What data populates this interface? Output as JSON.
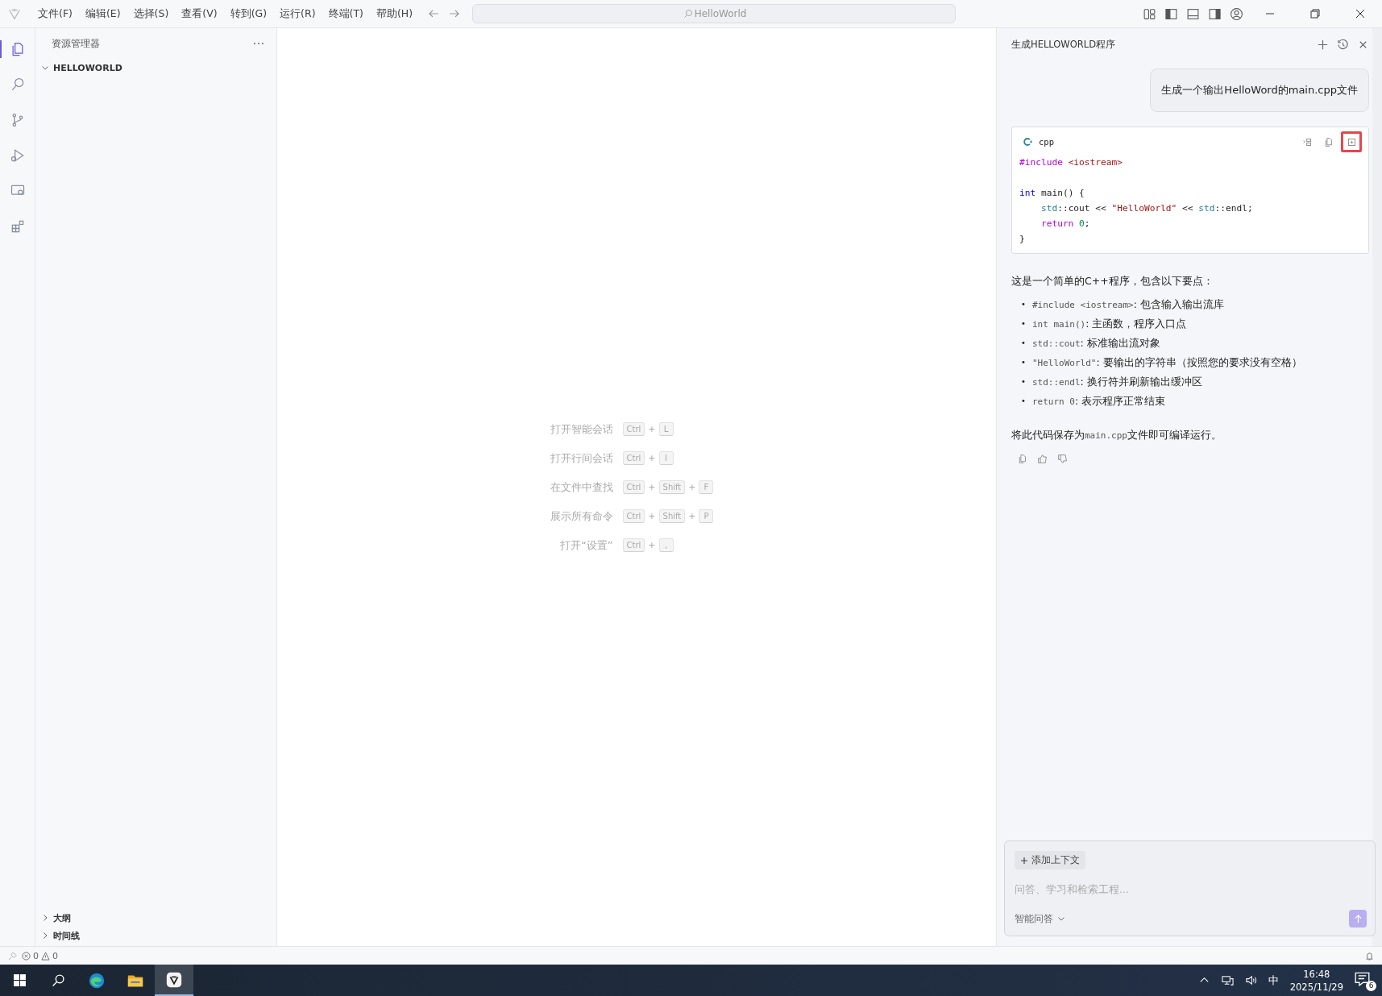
{
  "menu": [
    "文件(F)",
    "编辑(E)",
    "选择(S)",
    "查看(V)",
    "转到(G)",
    "运行(R)",
    "终端(T)",
    "帮助(H)"
  ],
  "title_search": {
    "placeholder": "HelloWorld"
  },
  "activity_bar": [
    {
      "kind": "explorer",
      "selected": true
    },
    {
      "kind": "search",
      "selected": false
    },
    {
      "kind": "source-control",
      "selected": false
    },
    {
      "kind": "run",
      "selected": false
    },
    {
      "kind": "remote",
      "selected": false
    },
    {
      "kind": "extensions",
      "selected": false
    }
  ],
  "explorer": {
    "title": "资源管理器",
    "folder": {
      "label": "HELLOWORLD",
      "expanded": true
    },
    "sections": [
      {
        "label": "大纲",
        "expanded": false
      },
      {
        "label": "时间线",
        "expanded": false
      }
    ]
  },
  "shortcuts": [
    {
      "label": "打开智能会话",
      "keys": [
        {
          "kind": "key",
          "text": "Ctrl"
        },
        {
          "kind": "plus",
          "text": "+"
        },
        {
          "kind": "key",
          "text": "L"
        }
      ]
    },
    {
      "label": "打开行间会话",
      "keys": [
        {
          "kind": "key",
          "text": "Ctrl"
        },
        {
          "kind": "plus",
          "text": "+"
        },
        {
          "kind": "key",
          "text": "I"
        }
      ]
    },
    {
      "label": "在文件中查找",
      "keys": [
        {
          "kind": "key",
          "text": "Ctrl"
        },
        {
          "kind": "plus",
          "text": "+"
        },
        {
          "kind": "key",
          "text": "Shift"
        },
        {
          "kind": "plus",
          "text": "+"
        },
        {
          "kind": "key",
          "text": "F"
        }
      ]
    },
    {
      "label": "展示所有命令",
      "keys": [
        {
          "kind": "key",
          "text": "Ctrl"
        },
        {
          "kind": "plus",
          "text": "+"
        },
        {
          "kind": "key",
          "text": "Shift"
        },
        {
          "kind": "plus",
          "text": "+"
        },
        {
          "kind": "key",
          "text": "P"
        }
      ]
    },
    {
      "label": "打开“设置”",
      "keys": [
        {
          "kind": "key",
          "text": "Ctrl"
        },
        {
          "kind": "plus",
          "text": "+"
        },
        {
          "kind": "key",
          "text": ","
        }
      ]
    }
  ],
  "chat": {
    "title": "生成HELLOWORLD程序",
    "user_message": "生成一个输出HelloWord的main.cpp文件",
    "code_block": {
      "language": "cpp",
      "actions": [
        {
          "kind": "insert",
          "highlighted": false
        },
        {
          "kind": "copy",
          "highlighted": false
        },
        {
          "kind": "apply",
          "highlighted": true
        }
      ],
      "lines": [
        {
          "kind": "code",
          "tokens": [
            {
              "kind": "directive",
              "text": "#include"
            },
            {
              "kind": "header",
              "text": " <iostream>"
            }
          ]
        },
        {
          "kind": "blank"
        },
        {
          "kind": "code",
          "tokens": [
            {
              "kind": "keyword",
              "text": "int"
            },
            {
              "kind": "plain",
              "text": " main() {"
            }
          ]
        },
        {
          "kind": "code",
          "tokens": [
            {
              "kind": "namespace",
              "text": "    std"
            },
            {
              "kind": "plain",
              "text": "::cout << "
            },
            {
              "kind": "string",
              "text": "\"HelloWorld\""
            },
            {
              "kind": "plain",
              "text": " << "
            },
            {
              "kind": "namespace",
              "text": "std"
            },
            {
              "kind": "plain",
              "text": "::endl;"
            }
          ]
        },
        {
          "kind": "code",
          "tokens": [
            {
              "kind": "control",
              "text": "    return"
            },
            {
              "kind": "number",
              "text": " 0"
            },
            {
              "kind": "plain",
              "text": ";"
            }
          ]
        },
        {
          "kind": "code",
          "tokens": [
            {
              "kind": "plain",
              "text": "}"
            }
          ]
        }
      ]
    },
    "intro": "这是一个简单的C++程序，包含以下要点：",
    "points": [
      {
        "marker": "•",
        "code": "#include <iostream>",
        "text": ": 包含输入输出流库"
      },
      {
        "marker": "•",
        "code": "int main()",
        "text": ": 主函数，程序入口点"
      },
      {
        "marker": "•",
        "code": "std::cout",
        "text": ": 标准输出流对象"
      },
      {
        "marker": "•",
        "code": "\"HelloWorld\"",
        "text": ": 要输出的字符串（按照您的要求没有空格）"
      },
      {
        "marker": "•",
        "code": "std::endl",
        "text": ": 换行符并刷新输出缓冲区"
      },
      {
        "marker": "•",
        "code": "return 0",
        "text": ": 表示程序正常结束"
      }
    ],
    "closing": [
      {
        "kind": "text",
        "text": "将此代码保存为"
      },
      {
        "kind": "code",
        "text": "main.cpp"
      },
      {
        "kind": "text",
        "text": "文件即可编译运行。"
      }
    ],
    "input": {
      "add_context": "添加上下文",
      "placeholder": "问答、学习和检索工程...",
      "mode": "智能问答",
      "send_disabled": true
    }
  },
  "status_bar": {
    "errors": "0",
    "warnings": "0"
  },
  "taskbar": {
    "apps": [
      {
        "kind": "browser",
        "selected": false
      },
      {
        "kind": "folder",
        "selected": false
      },
      {
        "kind": "ide",
        "selected": true
      }
    ],
    "ime": "中",
    "time": "16:48",
    "date": "2025/11/29",
    "notifications": "6"
  }
}
